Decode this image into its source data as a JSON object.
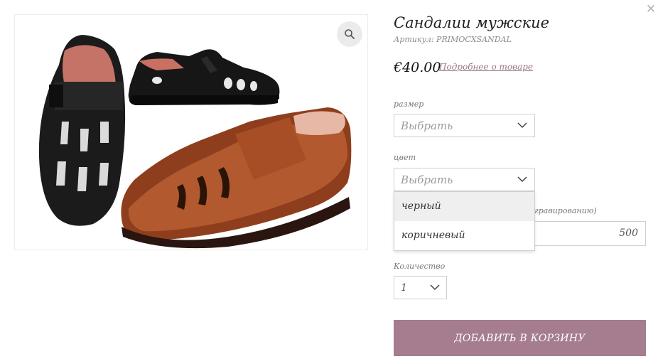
{
  "product": {
    "title": "Сандалии мужские",
    "sku": "Артикул: PRIMOCXSANDAL",
    "price": "€40.00",
    "details_link": "Подробнее о товаре"
  },
  "options": {
    "size": {
      "label": "размер",
      "value": "Выбрать"
    },
    "color": {
      "label": "цвет",
      "value": "Выбрать",
      "options": [
        "черный",
        "коричневый"
      ],
      "highlighted": "черный"
    },
    "engraving": {
      "label_visible": "сгравированию)",
      "value": "500"
    },
    "quantity": {
      "label": "Количество",
      "value": "1"
    }
  },
  "buttons": {
    "add_to_cart": "ДОБАВИТЬ В КОРЗИНУ"
  },
  "icons": {
    "close": "close-icon",
    "zoom": "magnifier-icon",
    "chevron": "chevron-down-icon"
  },
  "colors": {
    "accent_button": "#a57d8e",
    "link": "#9c7a8a",
    "border": "#cfcfcf",
    "highlight": "#efefef"
  }
}
